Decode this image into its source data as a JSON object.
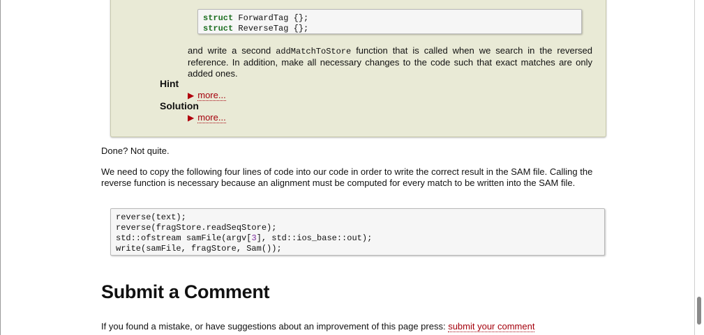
{
  "assignment": {
    "code_lines": [
      {
        "kw": "struct",
        "rest": " ForwardTag {};"
      },
      {
        "kw": "struct",
        "rest": " ReverseTag {};"
      }
    ],
    "para_before": "and write a second ",
    "para_code": "addMatchToStore",
    "para_after": " function that is called when we search in the reversed reference. In addition, make all necessary changes to the code such that exact matches are only added ones.",
    "hint_label": "Hint",
    "solution_label": "Solution",
    "more_label": "more..."
  },
  "body": {
    "done_text": "Done? Not quite.",
    "paragraph": "We need to copy the following four lines of code into our code in order to write the correct result in the SAM file. Calling the reverse function is necessary because an alignment must be computed for every match to be written into the SAM file.",
    "code": {
      "line1": "reverse(text);",
      "line2": "reverse(fragStore.readSeqStore);",
      "line3_before": "std::ofstream samFile(argv[",
      "line3_num": "3",
      "line3_after": "], std::ios_base::out);",
      "line4": "write(samFile, fragStore, Sam());"
    }
  },
  "comment": {
    "heading": "Submit a Comment",
    "text": "If you found a mistake, or have suggestions about an improvement of this page press: ",
    "link": "submit your comment"
  },
  "colors": {
    "box_background": "#e9ead6",
    "keyword": "#1d6f21",
    "link": "#a5000c"
  },
  "icons": {
    "expand": "triangle-right-icon"
  }
}
